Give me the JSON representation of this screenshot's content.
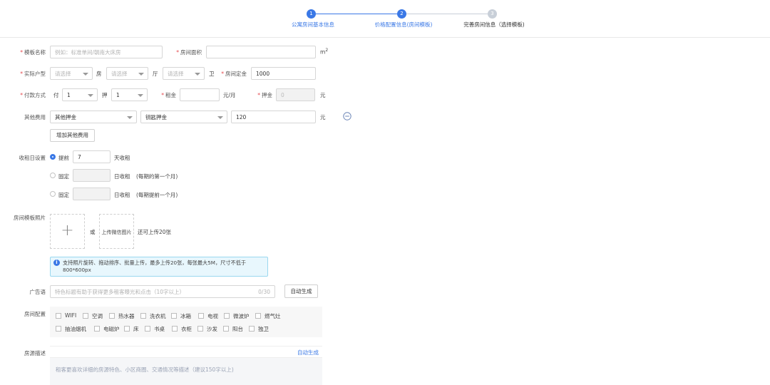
{
  "steps": [
    {
      "num": "1",
      "label": "公寓房间基本信息",
      "state": "active"
    },
    {
      "num": "2",
      "label": "价格配置信息(房间模板)",
      "state": "active"
    },
    {
      "num": "3",
      "label": "完善房间信息（选择模板)",
      "state": "pending"
    }
  ],
  "form": {
    "template_name": {
      "label": "模板名称",
      "placeholder": "例如：标准单间/朝南大床房"
    },
    "room_area": {
      "label": "房间面积",
      "value": "",
      "unit_base": "m",
      "unit_sup": "2"
    },
    "layout": {
      "label": "实际户型",
      "room_placeholder": "请选择",
      "room_suffix": "房",
      "hall_placeholder": "请选择",
      "hall_suffix": "厅",
      "bath_placeholder": "请选择",
      "bath_suffix": "卫"
    },
    "deposit_fixed": {
      "label": "房间定金",
      "value": "1000"
    },
    "payment": {
      "label": "付款方式",
      "pay_prefix": "付",
      "pay_value": "1",
      "bet_prefix": "押",
      "bet_value": "1"
    },
    "rent": {
      "label": "租金",
      "value": "",
      "unit": "元/月"
    },
    "deposit": {
      "label": "押金",
      "value": "0",
      "unit": "元"
    },
    "other_fees": {
      "label": "其他费用",
      "type_value": "其他押金",
      "name_value": "钥匙押金",
      "amount_value": "120",
      "unit": "元"
    },
    "add_fee_button": "增加其他费用",
    "rent_day": {
      "label": "收租日设置",
      "opt1_prefix": "提前",
      "opt1_value": "7",
      "opt1_suffix": "天收租",
      "opt2_prefix": "固定",
      "opt2_suffix": "日收租",
      "opt2_note": "(每期的第一个月)",
      "opt3_prefix": "固定",
      "opt3_suffix": "日收租",
      "opt3_note": "(每期提前一个月)"
    },
    "photos": {
      "label": "房间模板照片",
      "plus": "+",
      "or": "或",
      "wechat_button": "上传微信图片",
      "remain": "还可上传20张",
      "info": "支持照片旋转、拖动排序、批量上传，最多上传20张，每张最大5M，尺寸不低于800*600px"
    },
    "ad": {
      "label": "广告语",
      "placeholder": "特色标题有助于获得更多租客曝光和点击（10字以上）",
      "counter": "0/30",
      "auto_button": "自动生成"
    },
    "facilities": {
      "label": "房间配置",
      "items": [
        "WIFI",
        "空调",
        "热水器",
        "洗衣机",
        "冰箱",
        "电视",
        "微波炉",
        "燃气灶",
        "抽油烟机",
        "电磁炉",
        "床",
        "书桌",
        "衣柜",
        "沙发",
        "阳台",
        "独卫"
      ]
    },
    "description": {
      "label": "房源描述",
      "auto": "自动生成",
      "placeholder": "租客更喜欢详细的房源特色、小区商圈、交通情况等描述（建议150字以上)"
    }
  },
  "colors": {
    "accent": "#3a78e6",
    "info_bg": "#e8f7fd",
    "info_border": "#9ad8ef"
  }
}
